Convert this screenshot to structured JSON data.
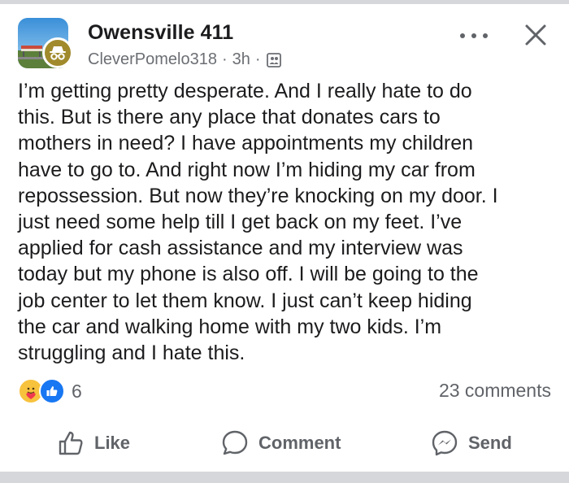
{
  "post": {
    "group_name": "Owensville 411",
    "author": "CleverPomelo318",
    "time": "3h",
    "separator": "·",
    "text": "I’m getting pretty desperate. And I really hate to do\nthis. But is there any place that donates cars to\nmothers in need? I have appointments my children\nhave to go to. And right now I’m hiding my car from\nrepossession. But now they’re knocking on my door. I\njust need some help till I get back on my feet. I’ve\napplied for cash assistance and my interview was\ntoday but my phone is also off. I will be going to the\njob center to let them know. I just can’t keep hiding\nthe car and walking home with my two kids. I’m\nstruggling and I hate this."
  },
  "reactions": {
    "count": "6",
    "types": [
      "care-reaction-icon",
      "like-reaction-icon"
    ]
  },
  "comments_label": "23 comments",
  "actions": {
    "like": "Like",
    "comment": "Comment",
    "send": "Send"
  },
  "colors": {
    "text": "#1c1c1e",
    "muted": "#606368",
    "like_blue": "#1877f2",
    "anon_badge": "#a08a2c"
  }
}
